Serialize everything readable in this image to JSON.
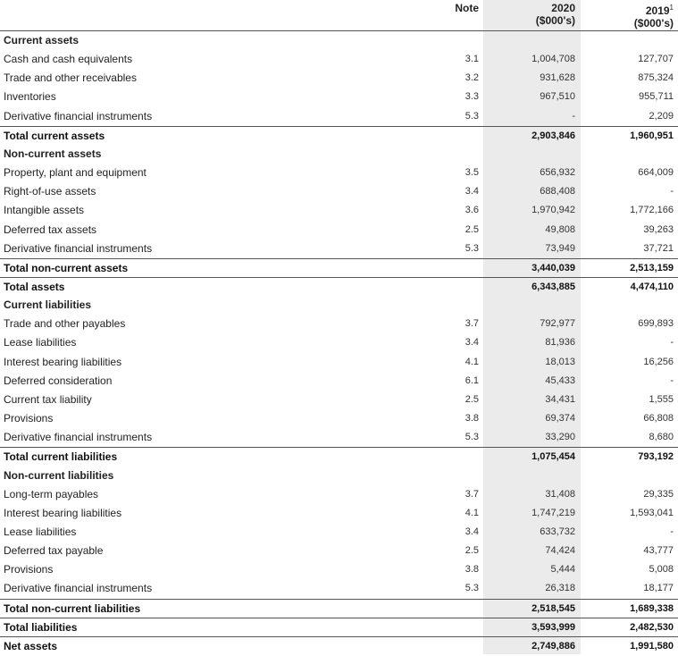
{
  "header": {
    "note": "Note",
    "y2020": "2020",
    "y2020_unit": "($000's)",
    "y2019": "2019",
    "y2019_sup": "1",
    "y2019_unit": "($000's)"
  },
  "rows": [
    {
      "label": "Current assets",
      "type": "section",
      "note": "",
      "v20": "",
      "v19": ""
    },
    {
      "label": "Cash and cash equivalents",
      "type": "item",
      "note": "3.1",
      "v20": "1,004,708",
      "v19": "127,707"
    },
    {
      "label": "Trade and other receivables",
      "type": "item",
      "note": "3.2",
      "v20": "931,628",
      "v19": "875,324"
    },
    {
      "label": "Inventories",
      "type": "item",
      "note": "3.3",
      "v20": "967,510",
      "v19": "955,711"
    },
    {
      "label": "Derivative financial instruments",
      "type": "item",
      "note": "5.3",
      "v20": "-",
      "v19": "2,209"
    },
    {
      "label": "Total current assets",
      "type": "total",
      "note": "",
      "v20": "2,903,846",
      "v19": "1,960,951"
    },
    {
      "label": "Non-current assets",
      "type": "section",
      "note": "",
      "v20": "",
      "v19": ""
    },
    {
      "label": "Property, plant and equipment",
      "type": "item",
      "note": "3.5",
      "v20": "656,932",
      "v19": "664,009"
    },
    {
      "label": "Right-of-use assets",
      "type": "item",
      "note": "3.4",
      "v20": "688,408",
      "v19": "-"
    },
    {
      "label": "Intangible assets",
      "type": "item",
      "note": "3.6",
      "v20": "1,970,942",
      "v19": "1,772,166"
    },
    {
      "label": "Deferred tax assets",
      "type": "item",
      "note": "2.5",
      "v20": "49,808",
      "v19": "39,263"
    },
    {
      "label": "Derivative financial instruments",
      "type": "item",
      "note": "5.3",
      "v20": "73,949",
      "v19": "37,721"
    },
    {
      "label": "Total non-current assets",
      "type": "total",
      "note": "",
      "v20": "3,440,039",
      "v19": "2,513,159"
    },
    {
      "label": "Total assets",
      "type": "total",
      "note": "",
      "v20": "6,343,885",
      "v19": "4,474,110"
    },
    {
      "label": "Current liabilities",
      "type": "section",
      "note": "",
      "v20": "",
      "v19": ""
    },
    {
      "label": "Trade and other payables",
      "type": "item",
      "note": "3.7",
      "v20": "792,977",
      "v19": "699,893"
    },
    {
      "label": "Lease liabilities",
      "type": "item",
      "note": "3.4",
      "v20": "81,936",
      "v19": "-"
    },
    {
      "label": "Interest bearing liabilities",
      "type": "item",
      "note": "4.1",
      "v20": "18,013",
      "v19": "16,256"
    },
    {
      "label": "Deferred consideration",
      "type": "item",
      "note": "6.1",
      "v20": "45,433",
      "v19": "-"
    },
    {
      "label": "Current tax liability",
      "type": "item",
      "note": "2.5",
      "v20": "34,431",
      "v19": "1,555"
    },
    {
      "label": "Provisions",
      "type": "item",
      "note": "3.8",
      "v20": "69,374",
      "v19": "66,808"
    },
    {
      "label": "Derivative financial instruments",
      "type": "item",
      "note": "5.3",
      "v20": "33,290",
      "v19": "8,680"
    },
    {
      "label": "Total current liabilities",
      "type": "total",
      "note": "",
      "v20": "1,075,454",
      "v19": "793,192"
    },
    {
      "label": "Non-current liabilities",
      "type": "section",
      "note": "",
      "v20": "",
      "v19": ""
    },
    {
      "label": "Long-term payables",
      "type": "item",
      "note": "3.7",
      "v20": "31,408",
      "v19": "29,335"
    },
    {
      "label": "Interest bearing liabilities",
      "type": "item",
      "note": "4.1",
      "v20": "1,747,219",
      "v19": "1,593,041"
    },
    {
      "label": "Lease liabilities",
      "type": "item",
      "note": "3.4",
      "v20": "633,732",
      "v19": "-"
    },
    {
      "label": "Deferred tax payable",
      "type": "item",
      "note": "2.5",
      "v20": "74,424",
      "v19": "43,777"
    },
    {
      "label": "Provisions",
      "type": "item",
      "note": "3.8",
      "v20": "5,444",
      "v19": "5,008"
    },
    {
      "label": "Derivative financial instruments",
      "type": "item",
      "note": "5.3",
      "v20": "26,318",
      "v19": "18,177"
    },
    {
      "label": "Total non-current liabilities",
      "type": "total",
      "note": "",
      "v20": "2,518,545",
      "v19": "1,689,338"
    },
    {
      "label": "Total liabilities",
      "type": "total",
      "note": "",
      "v20": "3,593,999",
      "v19": "2,482,530"
    },
    {
      "label": "Net assets",
      "type": "total",
      "note": "",
      "v20": "2,749,886",
      "v19": "1,991,580"
    }
  ]
}
